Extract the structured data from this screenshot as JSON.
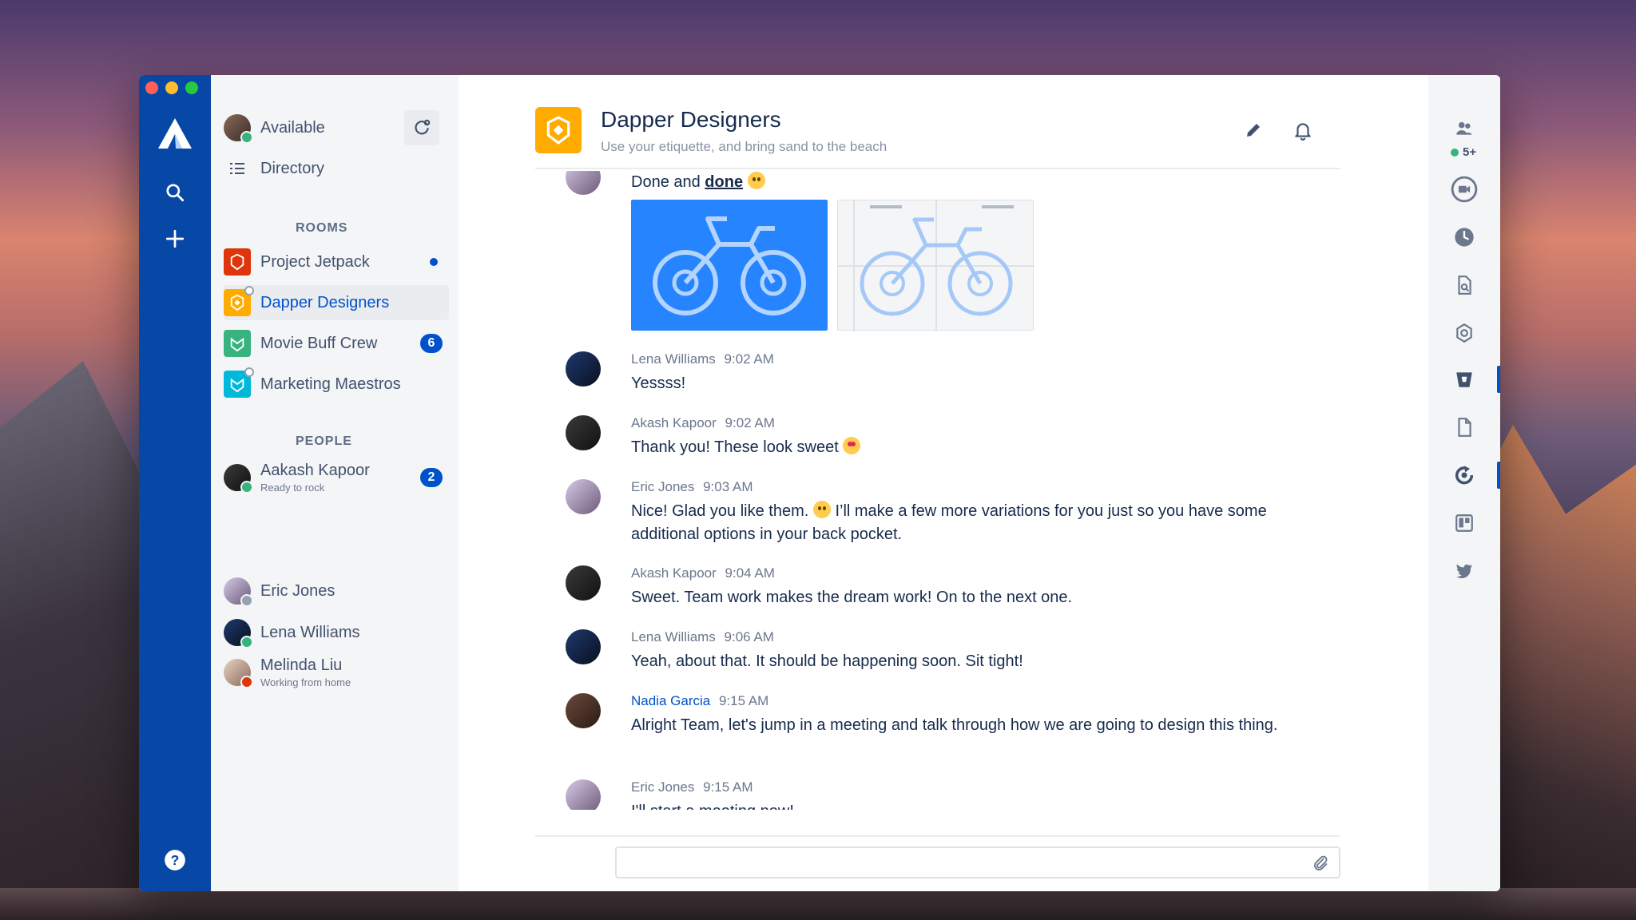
{
  "status": {
    "label": "Available"
  },
  "directory": {
    "label": "Directory"
  },
  "rooms": {
    "heading": "ROOMS",
    "items": [
      {
        "name": "Project Jetpack",
        "color": "#DE350B",
        "unread": true
      },
      {
        "name": "Dapper Designers",
        "color": "#FFAB00",
        "active": true
      },
      {
        "name": "Movie Buff Crew",
        "color": "#36B37E",
        "badge": "6"
      },
      {
        "name": "Marketing Maestros",
        "color": "#00B8D9"
      }
    ]
  },
  "people": {
    "heading": "PEOPLE",
    "items": [
      {
        "name": "Aakash Kapoor",
        "status": "Ready to rock",
        "badge": "2",
        "presence": "green"
      },
      {
        "name": "Eric Jones",
        "presence": "grey"
      },
      {
        "name": "Lena Williams",
        "presence": "green"
      },
      {
        "name": "Melinda Liu",
        "status": "Working from home",
        "presence": "red"
      }
    ]
  },
  "room": {
    "title": "Dapper Designers",
    "topic": "Use your etiquette, and bring sand to the beach"
  },
  "messages": [
    {
      "author": "",
      "time": "",
      "text_pre": "Done and ",
      "text_bold": "done",
      "emoji": "wink"
    },
    {
      "author": "Lena Williams",
      "time": "9:02 AM",
      "text": "Yessss!"
    },
    {
      "author": "Akash Kapoor",
      "time": "9:02 AM",
      "text": "Thank you! These look sweet",
      "emoji": "love"
    },
    {
      "author": "Eric Jones",
      "time": "9:03 AM",
      "text_pre": "Nice! Glad you like them.",
      "text": "I’ll make a few more variations for you just so you have some additional options in your back pocket.",
      "emoji": "blush"
    },
    {
      "author": "Akash Kapoor",
      "time": "9:04 AM",
      "text": "Sweet. Team work makes the dream work! On to the next one."
    },
    {
      "author": "Lena Williams",
      "time": "9:06 AM",
      "text": "Yeah, about that. It should be happening soon. Sit tight!"
    },
    {
      "author": "Nadia Garcia",
      "time": "9:15 AM",
      "text": "Alright Team, let's jump in a meeting and talk through how we are going to design this thing."
    },
    {
      "author": "Eric Jones",
      "time": "9:15 AM",
      "text": "I'll start a meeting now!"
    }
  ],
  "composer": {
    "placeholder": ""
  },
  "right_rail": {
    "participants_count": "5+",
    "icons": [
      "people-icon",
      "video-icon",
      "clock-icon",
      "file-search-icon",
      "gear-icon",
      "bitbucket-icon",
      "document-icon",
      "refresh-icon",
      "trello-icon",
      "twitter-icon"
    ]
  },
  "colors": {
    "rail": "#0747A6",
    "accent": "#0052CC",
    "sidebar": "#F4F5F7",
    "online": "#36B37E"
  }
}
